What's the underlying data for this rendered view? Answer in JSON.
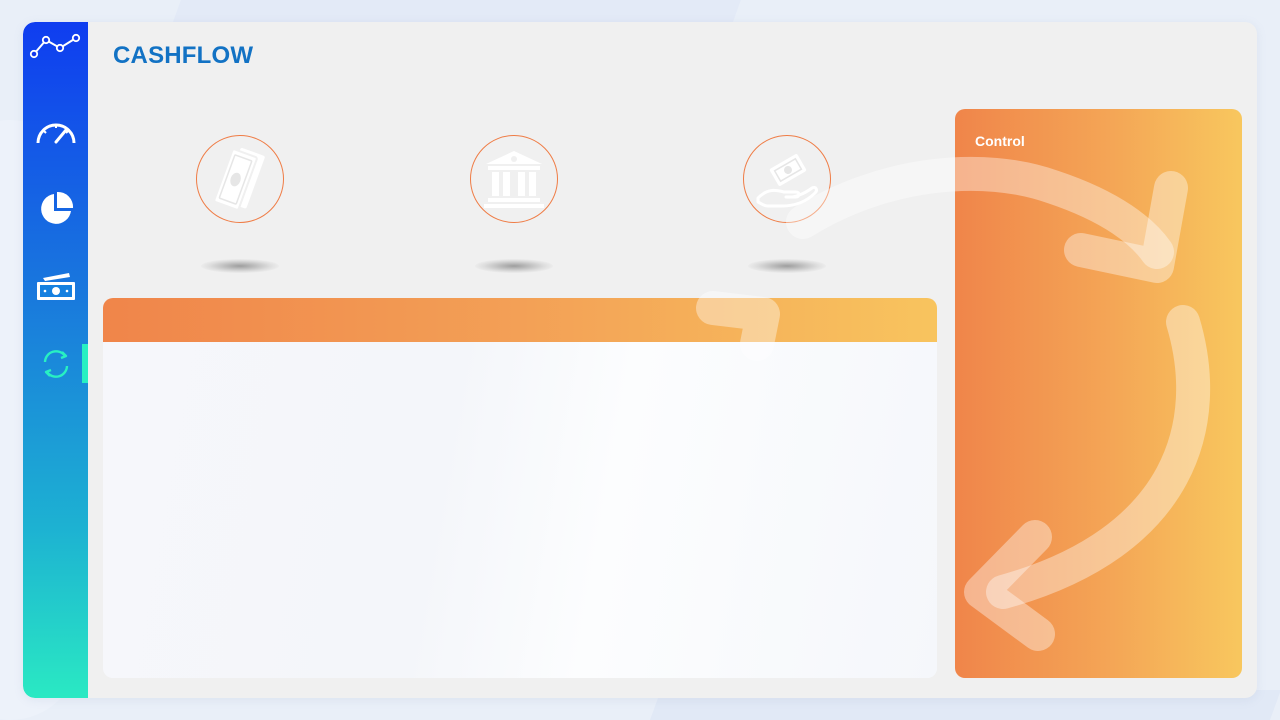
{
  "app": {
    "title": "CASHFLOW"
  },
  "sidebar": {
    "items": [
      {
        "icon": "trend-line-icon",
        "active": false
      },
      {
        "icon": "speedometer-icon",
        "active": false
      },
      {
        "icon": "pie-chart-icon",
        "active": false
      },
      {
        "icon": "cash-icon",
        "active": false
      },
      {
        "icon": "refresh-cycle-icon",
        "active": true
      }
    ],
    "active_color": "#28f0c2"
  },
  "kpis": [
    {
      "icon": "banknotes-icon",
      "label": ""
    },
    {
      "icon": "bank-building-icon",
      "label": ""
    },
    {
      "icon": "hand-money-icon",
      "label": ""
    }
  ],
  "main_card": {
    "header_label": ""
  },
  "control_panel": {
    "label": "Control"
  },
  "colors": {
    "title": "#1272c4",
    "accent_orange": "#f0854a",
    "accent_yellow": "#f8c75e",
    "sidebar_top": "#0f3df0",
    "sidebar_bottom": "#2ae9c3"
  }
}
